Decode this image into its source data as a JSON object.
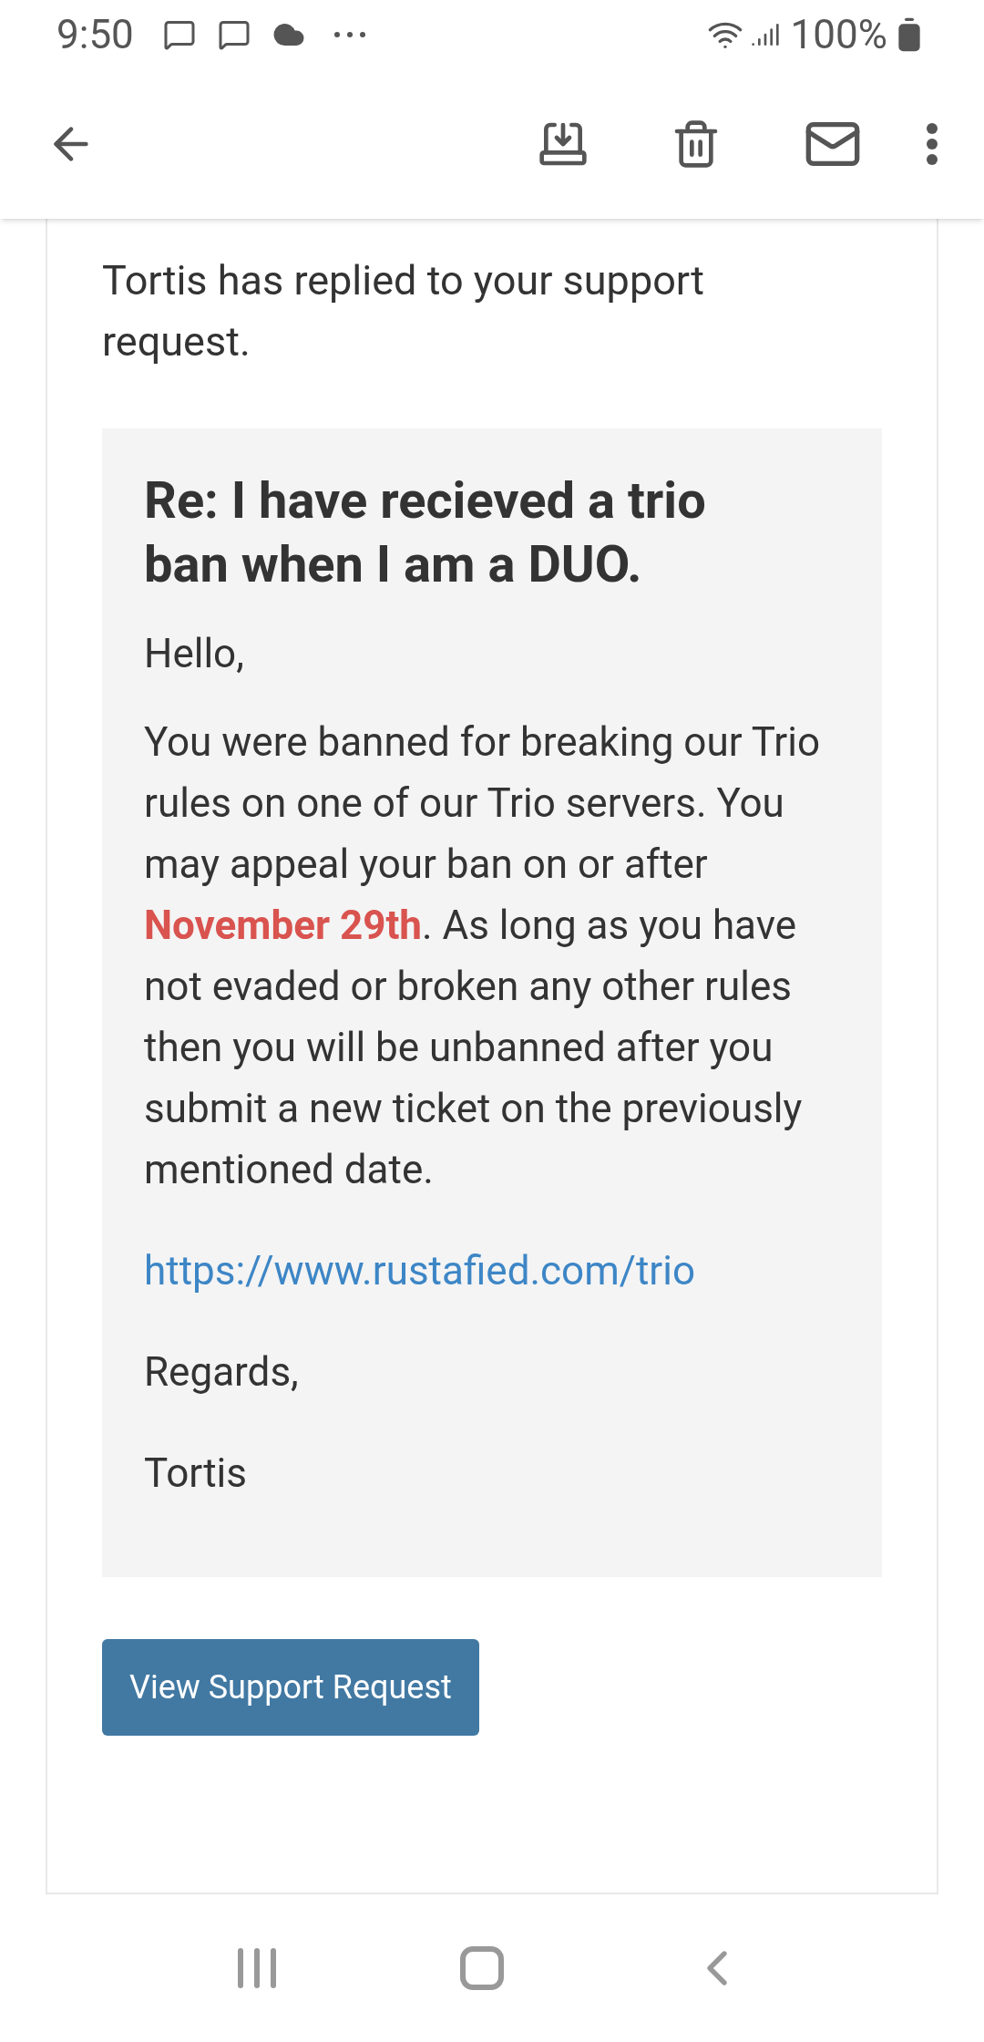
{
  "status_bar": {
    "time": "9:50",
    "battery": "100%"
  },
  "intro": "Tortis has replied to your support request.",
  "ticket": {
    "title": "Re: I have recieved a trio ban when I am a DUO.",
    "paragraphs": [
      "Hello,",
      "You were banned for breaking our Trio rules on one of our Trio servers. You may appeal your ban on or after **November 29th**. As long as you have not evaded or broken any other rules then you will be unbanned after you submit a new ticket on the previously mentioned date."
    ],
    "link": "https://www.rustafied.com/trio",
    "closing": [
      "Regards,",
      "Tortis"
    ]
  },
  "button": "View Support Request"
}
